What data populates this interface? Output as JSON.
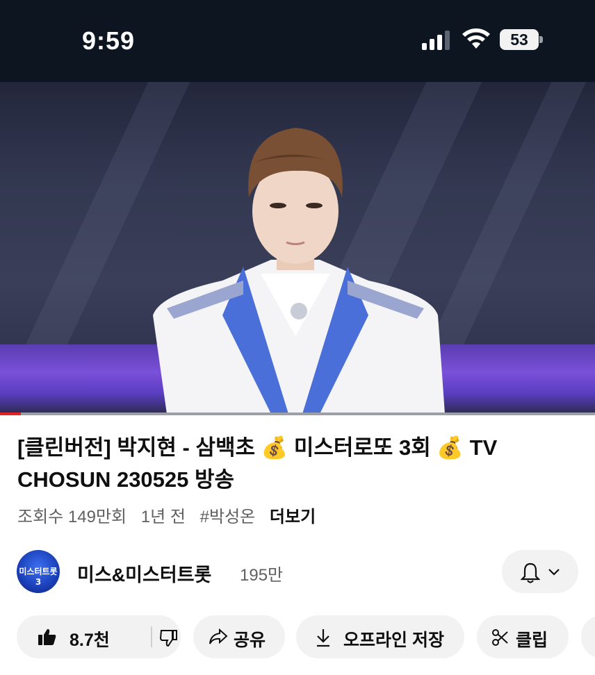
{
  "status_bar": {
    "time": "9:59",
    "battery": "53",
    "icons": [
      "cellular-signal-icon",
      "wifi-icon",
      "battery-icon"
    ]
  },
  "video": {
    "progress_fraction": 0.035,
    "progress_color": "#e52222"
  },
  "title": "[클린버전] 박지현 - 삼백초 💰 미스터로또 3회 💰 TV CHOSUN 230525 방송",
  "meta": {
    "views": "조회수 149만회",
    "age": "1년 전",
    "hashtag": "#박성온",
    "more_label": "더보기"
  },
  "channel": {
    "avatar_text": "미스터트롯3",
    "name": "미스&미스터트롯",
    "subscribers": "195만",
    "bell_icon": "bell-icon",
    "chevron_icon": "chevron-down-icon"
  },
  "actions": {
    "like_count": "8.7천",
    "share_label": "공유",
    "download_label": "오프라인 저장",
    "clip_label": "클립"
  },
  "colors": {
    "status_bg": "#0d1620",
    "pill_bg": "#f2f2f2",
    "text_primary": "#0f0f0f",
    "text_secondary": "#606060"
  }
}
